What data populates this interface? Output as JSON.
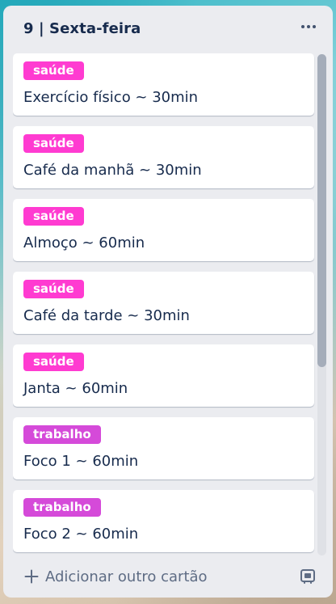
{
  "list": {
    "title": "9 | Sexta-feira",
    "cards": [
      {
        "label": "saúde",
        "title": "Exercício físico ~ 30min"
      },
      {
        "label": "saúde",
        "title": "Café da manhã ~ 30min"
      },
      {
        "label": "saúde",
        "title": "Almoço ~ 60min"
      },
      {
        "label": "saúde",
        "title": "Café da tarde ~ 30min"
      },
      {
        "label": "saúde",
        "title": "Janta ~ 60min"
      },
      {
        "label": "trabalho",
        "title": "Foco 1 ~ 60min"
      },
      {
        "label": "trabalho",
        "title": "Foco 2 ~ 60min"
      }
    ],
    "add_card_label": "Adicionar outro cartão"
  },
  "icons": {
    "menu": "more-horizontal-icon",
    "add": "plus-icon",
    "template": "card-template-icon"
  },
  "colors": {
    "label_saude": "#ff3bd1",
    "label_trabalho": "#d54ad9",
    "list_background": "#ebecf0"
  }
}
